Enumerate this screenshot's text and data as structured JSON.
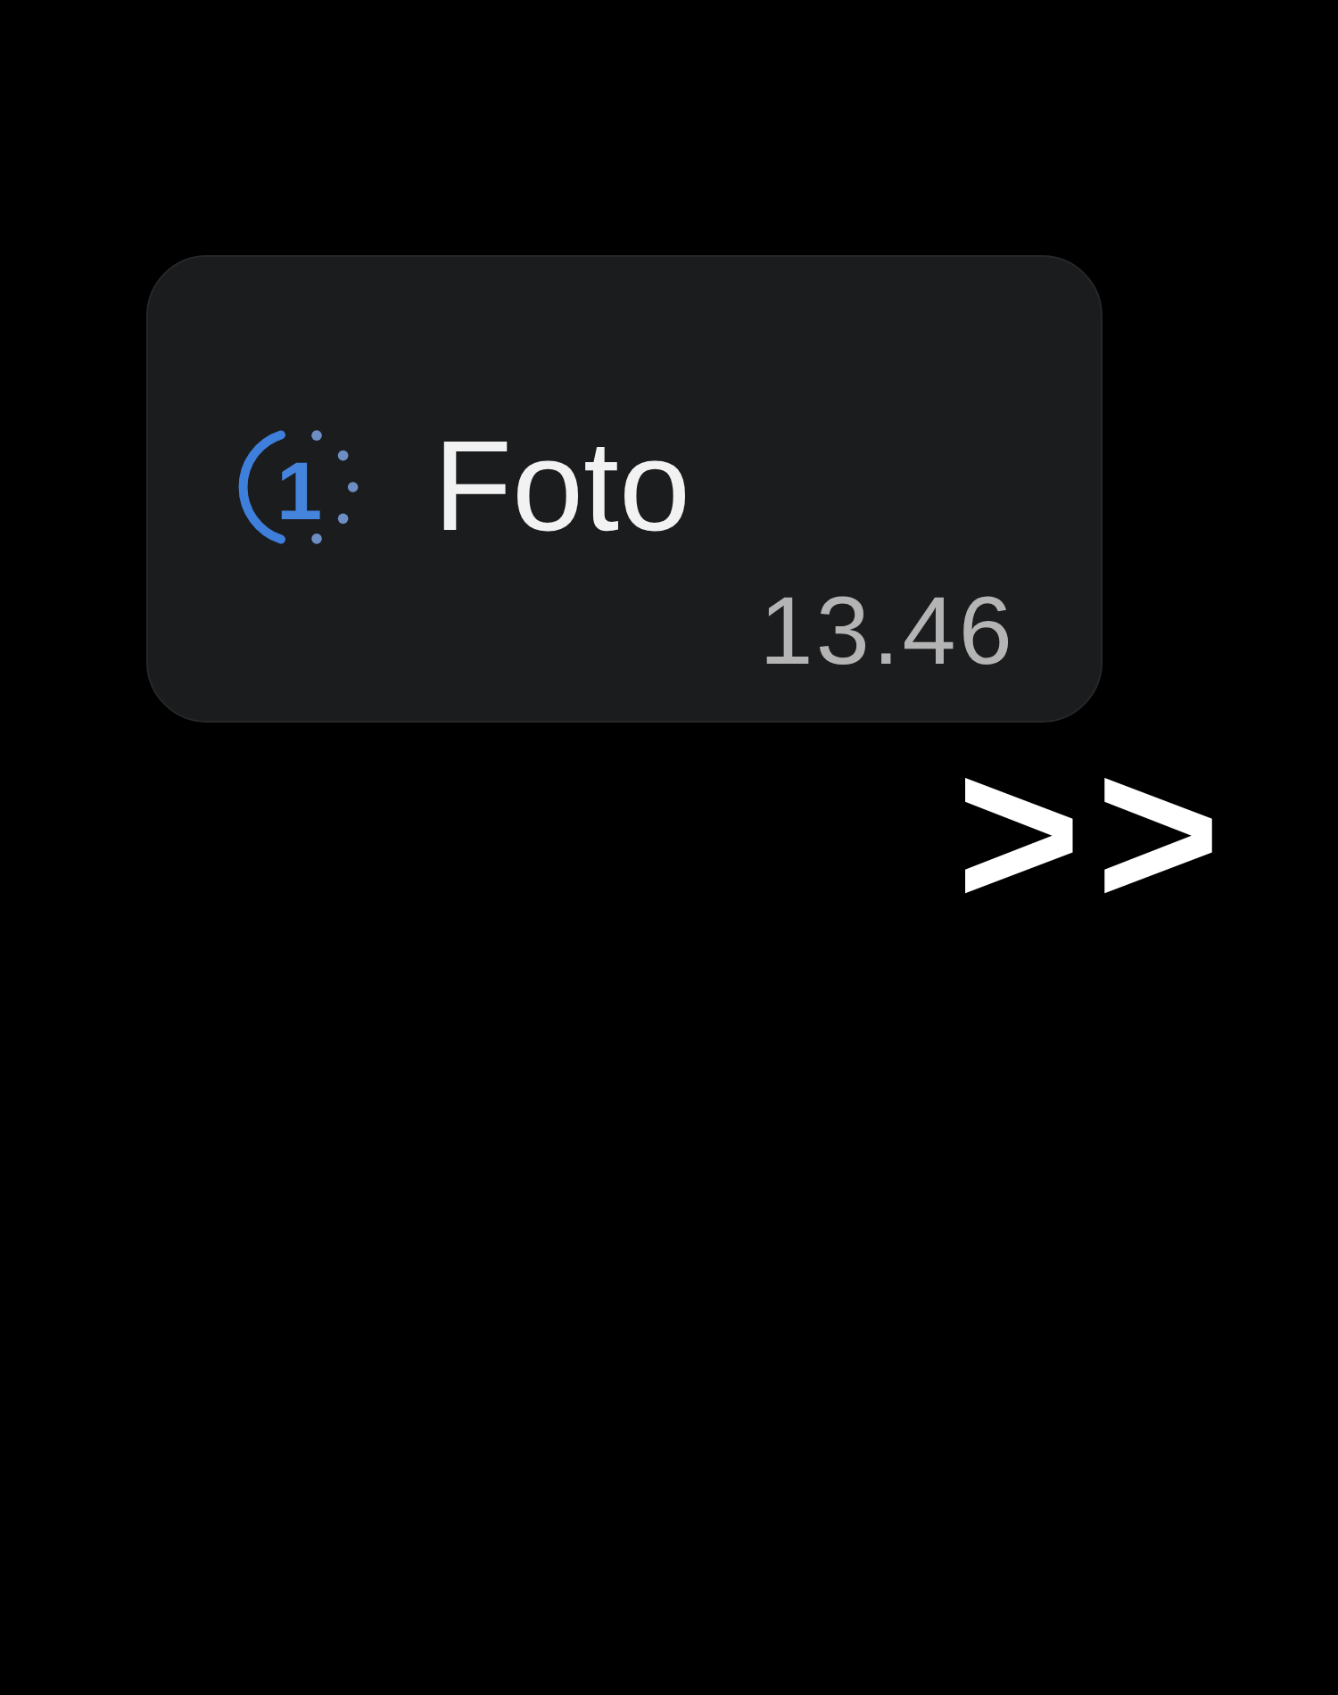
{
  "notification": {
    "badge": "1",
    "title": "Foto",
    "time": "13.46"
  },
  "overlay_text": ">>"
}
